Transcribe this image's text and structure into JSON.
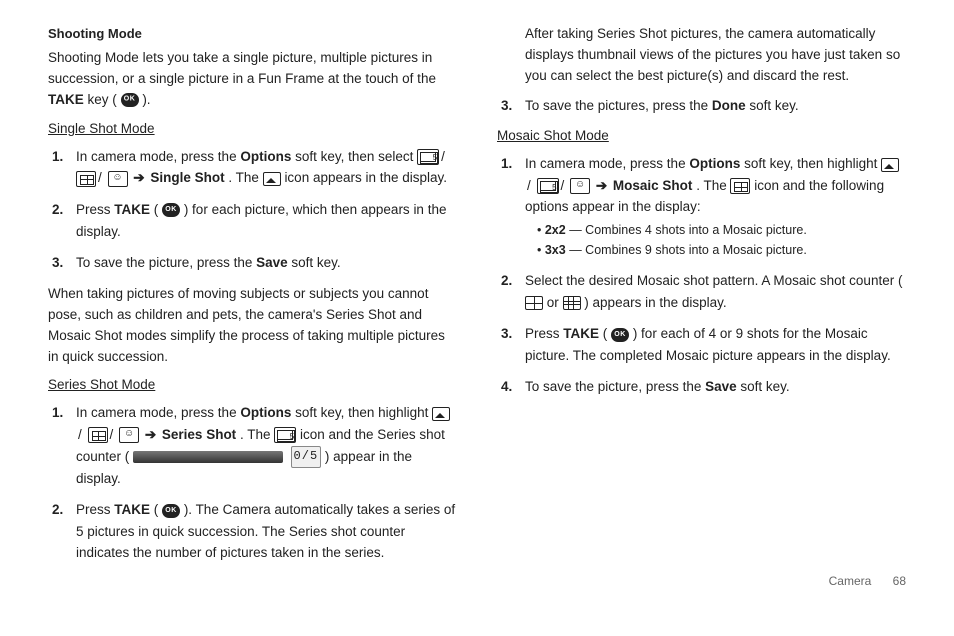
{
  "header": {
    "title": "Shooting Mode"
  },
  "intro": {
    "pre": "Shooting Mode lets you take a single picture, multiple pictures in succession, or a single picture in a Fun Frame at the touch of the ",
    "take": "TAKE",
    "mid": " key (",
    "post": ")."
  },
  "single": {
    "heading": "Single Shot Mode",
    "s1": {
      "num": "1.",
      "a": "In camera mode, press the ",
      "options": "Options",
      "b": " soft key, then select ",
      "label": "Single Shot",
      "c": ". The ",
      "d": " icon appears in the display."
    },
    "s2": {
      "num": "2.",
      "a": "Press ",
      "take": "TAKE",
      "b": " (",
      "c": ") for each picture, which then appears in the display."
    },
    "s3": {
      "num": "3.",
      "a": "To save the picture, press the ",
      "save": "Save",
      "b": " soft key."
    }
  },
  "paraMoving": "When taking pictures of moving subjects or subjects you cannot pose, such as children and pets, the camera's Series Shot and Mosaic Shot modes simplify the process of taking multiple pictures in quick succession.",
  "series": {
    "heading": "Series Shot Mode",
    "s1": {
      "num": "1.",
      "a": "In camera mode, press the ",
      "options": "Options",
      "b": " soft key, then highlight ",
      "label": "Series Shot",
      "c": ". The ",
      "d": " icon and the Series shot counter ( ",
      "counterNum": "0/5",
      "e": " ) appear in the display."
    },
    "s2": {
      "num": "2.",
      "a": "Press ",
      "take": "TAKE",
      "b": " (",
      "c": "). The Camera automatically takes a series of 5 pictures in quick succession. The Series shot counter indicates the number of pictures taken in the series."
    },
    "after2": "After taking Series Shot pictures, the camera automatically displays thumbnail views of the pictures you have just taken so you can select the best picture(s) and discard the rest.",
    "s3": {
      "num": "3.",
      "a": "To save the pictures, press the ",
      "done": "Done",
      "b": " soft key."
    }
  },
  "mosaic": {
    "heading": "Mosaic Shot Mode",
    "s1": {
      "num": "1.",
      "a": "In camera mode, press the ",
      "options": "Options",
      "b": " soft key, then highlight ",
      "label": "Mosaic Shot",
      "c": ". The ",
      "d": " icon and the following options appear in the display:"
    },
    "b1": {
      "label": "2x2",
      "desc": " — Combines 4 shots into a Mosaic picture."
    },
    "b2": {
      "label": "3x3",
      "desc": " — Combines 9 shots into a Mosaic picture."
    },
    "s2": {
      "num": "2.",
      "a": "Select the desired Mosaic shot pattern. A Mosaic shot counter ( ",
      "b": " or ",
      "c": " ) appears in the display."
    },
    "s3": {
      "num": "3.",
      "a": "Press ",
      "take": "TAKE",
      "b": " (",
      "c": ") for each of 4 or 9 shots for the Mosaic picture. The completed Mosaic picture appears in the display."
    },
    "s4": {
      "num": "4.",
      "a": "To save the picture, press the ",
      "save": "Save",
      "b": " soft key."
    }
  },
  "footer": {
    "section": "Camera",
    "page": "68"
  }
}
